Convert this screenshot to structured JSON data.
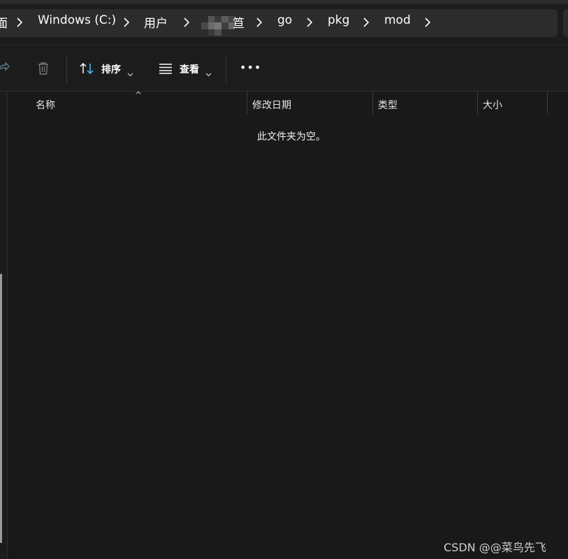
{
  "breadcrumb": {
    "items": [
      {
        "label": "面"
      },
      {
        "label": "Windows (C:)"
      },
      {
        "label": "用户"
      },
      {
        "label": "笪"
      },
      {
        "label": "go"
      },
      {
        "label": "pkg"
      },
      {
        "label": "mod"
      }
    ]
  },
  "toolbar": {
    "sort_label": "排序",
    "view_label": "查看",
    "more_label": "•••"
  },
  "columns": [
    {
      "label": "名称"
    },
    {
      "label": "修改日期"
    },
    {
      "label": "类型"
    },
    {
      "label": "大小"
    }
  ],
  "sort_indicator": "^",
  "empty_message": "此文件夹为空。",
  "watermark": "CSDN @@菜鸟先飞",
  "colors": {
    "background": "#191919",
    "toolbar_bg": "#1c1c1c",
    "breadcrumb_bg": "#2c2c2c",
    "text": "#ffffff",
    "accent_icon": "#4cc2ff"
  },
  "icons": [
    "share-icon",
    "delete-icon",
    "sort-icon",
    "view-list-icon",
    "chevron-down-icon",
    "more-icon",
    "chevron-right-icon"
  ]
}
